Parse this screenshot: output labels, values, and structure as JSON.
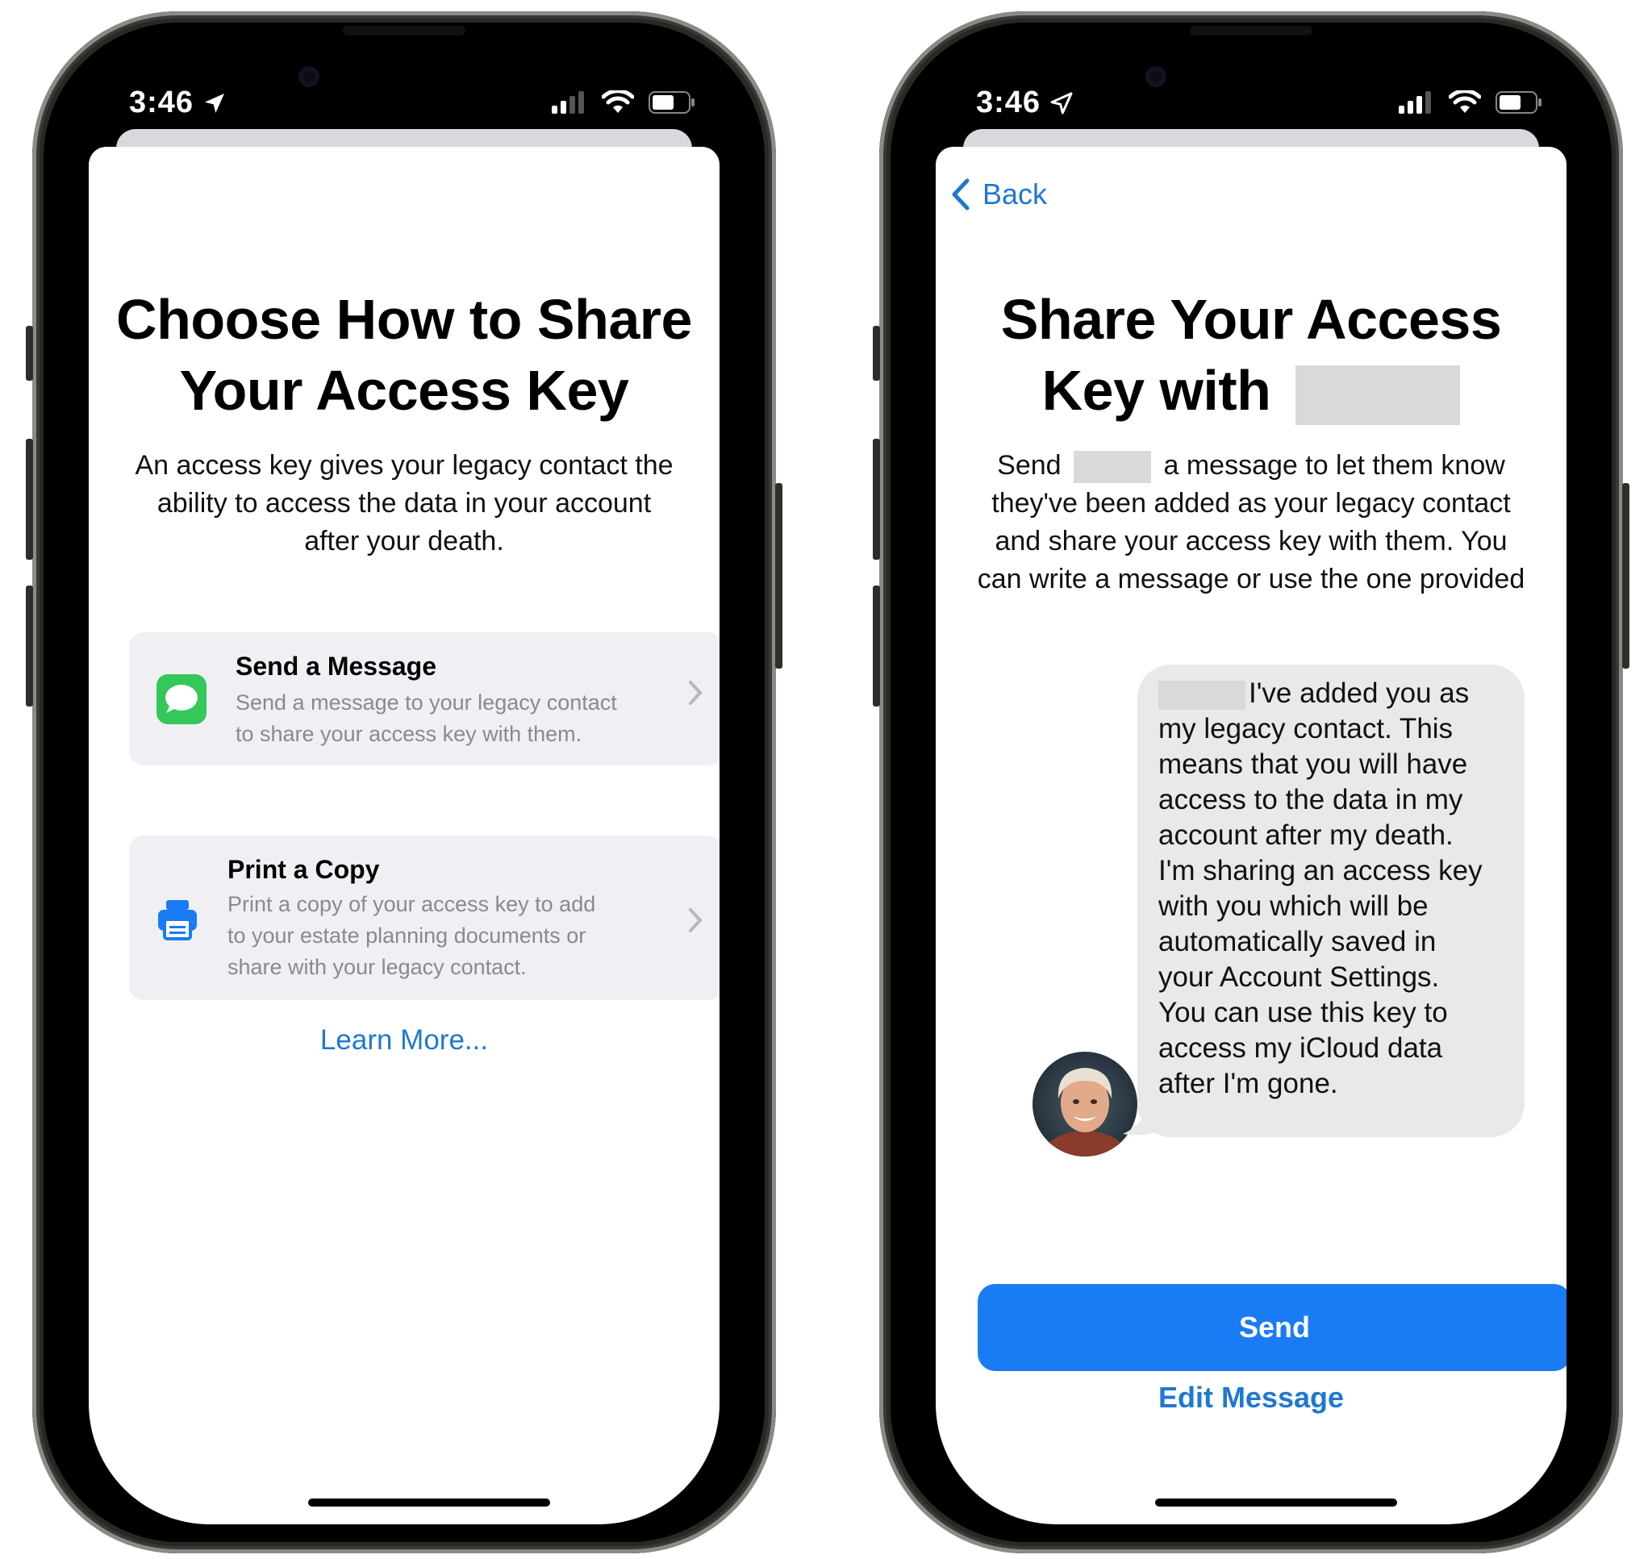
{
  "colors": {
    "accent_blue": "#1A7CF5",
    "link_blue": "#1F78D1",
    "messages_green": "#34C759",
    "card_bg": "#F0F0F4",
    "bubble_bg": "#E9E9EB"
  },
  "left": {
    "status": {
      "time": "3:46",
      "icons": [
        "location-arrow-icon",
        "signal-icon",
        "wifi-icon",
        "battery-icon"
      ]
    },
    "title_line1": "Choose How to Share",
    "title_line2": "Your Access Key",
    "description": [
      "An access key gives your legacy contact the",
      "ability to access the data in your account",
      "after your death."
    ],
    "options": [
      {
        "icon": "messages-icon",
        "title": "Send a Message",
        "desc": [
          "Send a message to your legacy contact",
          "to share your access key with them."
        ]
      },
      {
        "icon": "printer-icon",
        "title": "Print a Copy",
        "desc": [
          "Print a copy of your access key to add",
          "to your estate planning documents or",
          "share with your legacy contact."
        ]
      }
    ],
    "learn_more": "Learn More..."
  },
  "right": {
    "status": {
      "time": "3:46",
      "icons": [
        "location-arrow-outline-icon",
        "signal-icon",
        "wifi-icon",
        "battery-icon"
      ]
    },
    "back_label": "Back",
    "title_line1": "Share Your Access",
    "title_line2": "Key with",
    "description": [
      "Send",
      "a message to let them know",
      "they've been added as your legacy contact",
      "and share your access key with them. You",
      "can write a message or use the one provided"
    ],
    "message_lines": [
      "I've added you as",
      "my legacy contact. This",
      "means that you will have",
      "access to the data in my",
      "account after my death.",
      "I'm sharing an access key",
      "with you which will be",
      "automatically saved in",
      "your Account Settings.",
      "You can use this key to",
      "access my iCloud data",
      "after I'm gone."
    ],
    "send_label": "Send",
    "edit_label": "Edit Message"
  }
}
